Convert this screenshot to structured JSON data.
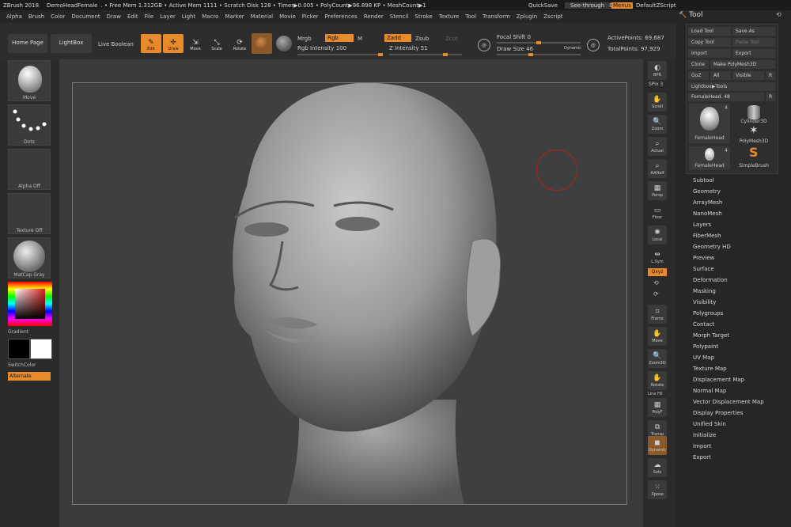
{
  "titlebar": {
    "app": "ZBrush 2018",
    "document": "DemoHeadFemale",
    "stats": ". • Free Mem 1.312GB • Active Mem 1111 • Scratch Disk 128 • Timer▶0.005 • PolyCount▶96.898 KP • MeshCount▶1",
    "quicksave": "QuickSave",
    "seethrough": "See-through",
    "seethrough_value": "0",
    "menus": "Menus",
    "default_zscript": "DefaultZScript"
  },
  "menubar": [
    "Alpha",
    "Brush",
    "Color",
    "Document",
    "Draw",
    "Edit",
    "File",
    "Layer",
    "Light",
    "Macro",
    "Marker",
    "Material",
    "Movie",
    "Picker",
    "Preferences",
    "Render",
    "Stencil",
    "Stroke",
    "Texture",
    "Tool",
    "Transform",
    "Zplugin",
    "Zscript"
  ],
  "toolbar": {
    "home_page": "Home Page",
    "lightbox": "LightBox",
    "live_boolean": "Live Boolean",
    "edit": "Edit",
    "draw": "Draw",
    "move": "Move",
    "scale": "Scale",
    "rotate": "Rotate",
    "mrgb": "Mrgb",
    "rgb": "Rgb",
    "m": "M",
    "zadd": "Zadd",
    "zsub": "Zsub",
    "zcut": "Zcut",
    "rgb_intensity_label": "Rgb Intensity",
    "rgb_intensity": "100",
    "z_intensity_label": "Z Intensity",
    "z_intensity": "51",
    "focal_shift_label": "Focal Shift",
    "focal_shift": "0",
    "draw_size_label": "Draw Size",
    "draw_size": "46",
    "dynamic": "Dynamic",
    "active_points_label": "ActivePoints:",
    "active_points": "69,687",
    "total_points_label": "TotalPoints:",
    "total_points": "97,929"
  },
  "leftpanel": {
    "brush": "Move",
    "stroke": "Dots",
    "alpha": "Alpha Off",
    "texture": "Texture Off",
    "material": "MatCap Gray",
    "gradient": "Gradient",
    "switchcolor": "SwitchColor",
    "alternate": "Alternate"
  },
  "shelf": [
    {
      "label": "BPR",
      "icon": "bpr-icon"
    },
    {
      "label": "SPix 3",
      "icon": "spix-icon"
    },
    {
      "label": "Scroll",
      "icon": "scroll-icon"
    },
    {
      "label": "Zoom",
      "icon": "zoom-icon"
    },
    {
      "label": "Actual",
      "icon": "actual-icon"
    },
    {
      "label": "AAHalf",
      "icon": "aahalf-icon"
    },
    {
      "label": "Persp",
      "icon": "persp-icon"
    },
    {
      "label": "Floor",
      "icon": "floor-icon"
    },
    {
      "label": "Local",
      "icon": "local-icon"
    },
    {
      "label": "L.Sym",
      "icon": "lsym-icon"
    },
    {
      "label": "Qxyz",
      "icon": "xyz-icon"
    },
    {
      "label": "Frame",
      "icon": "frame-icon"
    },
    {
      "label": "Move",
      "icon": "move-icon"
    },
    {
      "label": "Zoom3D",
      "icon": "zoom3d-icon"
    },
    {
      "label": "Rotate",
      "icon": "rotate-icon"
    },
    {
      "label": "Line Fill",
      "icon": "polyf-icon"
    },
    {
      "label": "PolyF",
      "icon": "polyf2-icon"
    },
    {
      "label": "Transp",
      "icon": "transp-icon"
    },
    {
      "label": "Dynamic",
      "icon": "dynamic-icon"
    },
    {
      "label": "Solo",
      "icon": "solo-icon"
    },
    {
      "label": "Xpose",
      "icon": "xpose-icon"
    }
  ],
  "tool": {
    "title": "Tool",
    "load_tool": "Load Tool",
    "save_as": "Save As",
    "copy_tool": "Copy Tool",
    "paste_tool": "Paste Tool",
    "import": "Import",
    "export": "Export",
    "clone": "Clone",
    "make_polymesh": "Make PolyMesh3D",
    "goz": "GoZ",
    "all": "All",
    "visible": "Visible",
    "r": "R",
    "lightbox_tools": "Lightbox▶Tools",
    "current_tool": "FemaleHead.",
    "current_tool_value": "48",
    "thumbs": [
      {
        "label": "FemaleHead",
        "count": "4"
      },
      {
        "label": "Cylinder3D",
        "count": ""
      },
      {
        "label": "PolyMesh3D",
        "count": ""
      },
      {
        "label": "FemaleHead",
        "count": "4"
      },
      {
        "label": "SimpleBrush",
        "count": ""
      }
    ],
    "subpalettes": [
      "Subtool",
      "Geometry",
      "ArrayMesh",
      "NanoMesh",
      "Layers",
      "FiberMesh",
      "Geometry HD",
      "Preview",
      "Surface",
      "Deformation",
      "Masking",
      "Visibility",
      "Polygroups",
      "Contact",
      "Morph Target",
      "Polypaint",
      "UV Map",
      "Texture Map",
      "Displacement Map",
      "Normal Map",
      "Vector Displacement Map",
      "Display Properties",
      "Unified Skin",
      "Initialize",
      "Import",
      "Export"
    ]
  },
  "colors": {
    "accent": "#e8892b",
    "background": "#2a2a2a",
    "canvas": "#3f3f3f"
  }
}
